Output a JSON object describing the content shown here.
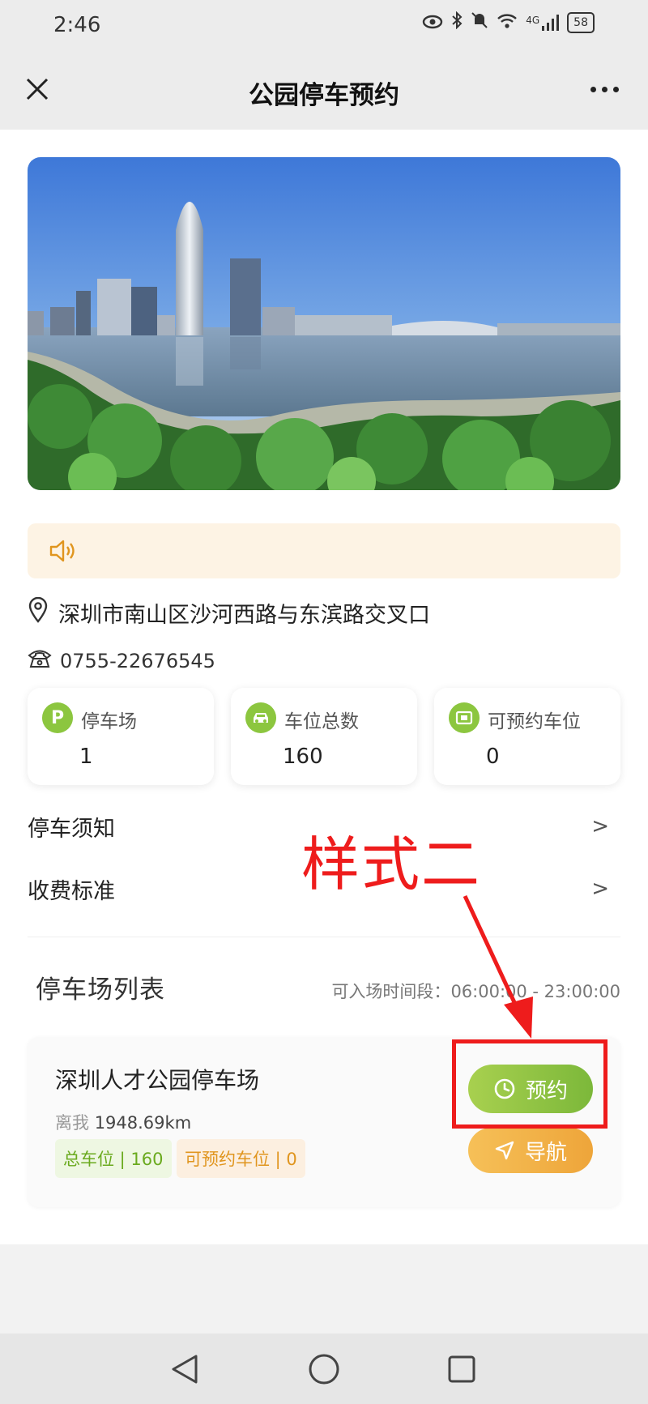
{
  "status_bar": {
    "time": "2:46",
    "network": "4G",
    "battery": "58"
  },
  "header": {
    "title": "公园停车预约"
  },
  "notice": {
    "icon": "speaker-icon"
  },
  "park": {
    "address": "深圳市南山区沙河西路与东滨路交叉口",
    "phone": "0755-22676545"
  },
  "stats": [
    {
      "icon": "parking-icon",
      "badge": "P",
      "label": "停车场",
      "value": "1"
    },
    {
      "icon": "car-icon",
      "label": "车位总数",
      "value": "160"
    },
    {
      "icon": "reservable-space-icon",
      "label": "可预约车位",
      "value": "0"
    }
  ],
  "menu": {
    "rules": "停车须知",
    "fees": "收费标准",
    "chevron": ">"
  },
  "lot_list": {
    "title": "停车场列表",
    "hours_label": "可入场时间段：",
    "hours": "06:00:00 - 23:00:00"
  },
  "lot": {
    "name": "深圳人才公园停车场",
    "distance_label": "离我",
    "distance": "1948.69km",
    "total_tag": "总车位 | 160",
    "available_tag": "可预约车位 | 0",
    "reserve_label": "预约",
    "navigate_label": "导航"
  },
  "annotation": {
    "text": "样式二",
    "color": "#ee1c1c"
  },
  "colors": {
    "accent_green": "#8cc63f",
    "accent_orange": "#eea53a",
    "notice_bg": "#fdf3e4"
  }
}
